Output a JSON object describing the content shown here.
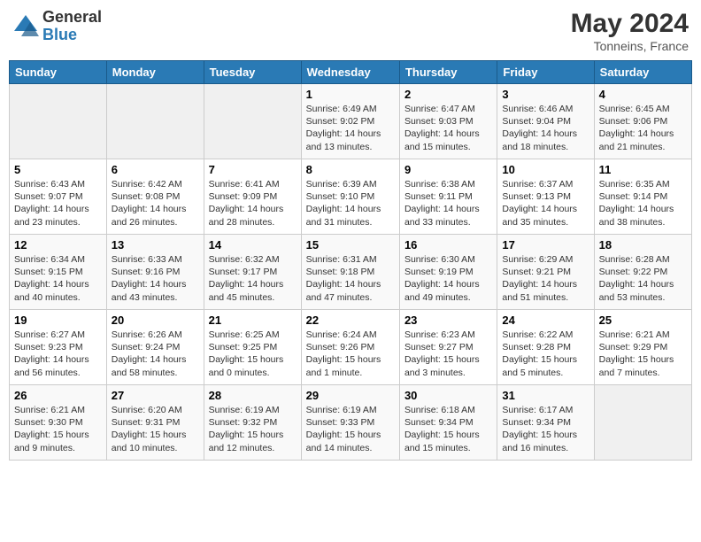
{
  "header": {
    "logo_general": "General",
    "logo_blue": "Blue",
    "month_year": "May 2024",
    "location": "Tonneins, France"
  },
  "days_of_week": [
    "Sunday",
    "Monday",
    "Tuesday",
    "Wednesday",
    "Thursday",
    "Friday",
    "Saturday"
  ],
  "weeks": [
    [
      {
        "num": "",
        "info": ""
      },
      {
        "num": "",
        "info": ""
      },
      {
        "num": "",
        "info": ""
      },
      {
        "num": "1",
        "info": "Sunrise: 6:49 AM\nSunset: 9:02 PM\nDaylight: 14 hours and 13 minutes."
      },
      {
        "num": "2",
        "info": "Sunrise: 6:47 AM\nSunset: 9:03 PM\nDaylight: 14 hours and 15 minutes."
      },
      {
        "num": "3",
        "info": "Sunrise: 6:46 AM\nSunset: 9:04 PM\nDaylight: 14 hours and 18 minutes."
      },
      {
        "num": "4",
        "info": "Sunrise: 6:45 AM\nSunset: 9:06 PM\nDaylight: 14 hours and 21 minutes."
      }
    ],
    [
      {
        "num": "5",
        "info": "Sunrise: 6:43 AM\nSunset: 9:07 PM\nDaylight: 14 hours and 23 minutes."
      },
      {
        "num": "6",
        "info": "Sunrise: 6:42 AM\nSunset: 9:08 PM\nDaylight: 14 hours and 26 minutes."
      },
      {
        "num": "7",
        "info": "Sunrise: 6:41 AM\nSunset: 9:09 PM\nDaylight: 14 hours and 28 minutes."
      },
      {
        "num": "8",
        "info": "Sunrise: 6:39 AM\nSunset: 9:10 PM\nDaylight: 14 hours and 31 minutes."
      },
      {
        "num": "9",
        "info": "Sunrise: 6:38 AM\nSunset: 9:11 PM\nDaylight: 14 hours and 33 minutes."
      },
      {
        "num": "10",
        "info": "Sunrise: 6:37 AM\nSunset: 9:13 PM\nDaylight: 14 hours and 35 minutes."
      },
      {
        "num": "11",
        "info": "Sunrise: 6:35 AM\nSunset: 9:14 PM\nDaylight: 14 hours and 38 minutes."
      }
    ],
    [
      {
        "num": "12",
        "info": "Sunrise: 6:34 AM\nSunset: 9:15 PM\nDaylight: 14 hours and 40 minutes."
      },
      {
        "num": "13",
        "info": "Sunrise: 6:33 AM\nSunset: 9:16 PM\nDaylight: 14 hours and 43 minutes."
      },
      {
        "num": "14",
        "info": "Sunrise: 6:32 AM\nSunset: 9:17 PM\nDaylight: 14 hours and 45 minutes."
      },
      {
        "num": "15",
        "info": "Sunrise: 6:31 AM\nSunset: 9:18 PM\nDaylight: 14 hours and 47 minutes."
      },
      {
        "num": "16",
        "info": "Sunrise: 6:30 AM\nSunset: 9:19 PM\nDaylight: 14 hours and 49 minutes."
      },
      {
        "num": "17",
        "info": "Sunrise: 6:29 AM\nSunset: 9:21 PM\nDaylight: 14 hours and 51 minutes."
      },
      {
        "num": "18",
        "info": "Sunrise: 6:28 AM\nSunset: 9:22 PM\nDaylight: 14 hours and 53 minutes."
      }
    ],
    [
      {
        "num": "19",
        "info": "Sunrise: 6:27 AM\nSunset: 9:23 PM\nDaylight: 14 hours and 56 minutes."
      },
      {
        "num": "20",
        "info": "Sunrise: 6:26 AM\nSunset: 9:24 PM\nDaylight: 14 hours and 58 minutes."
      },
      {
        "num": "21",
        "info": "Sunrise: 6:25 AM\nSunset: 9:25 PM\nDaylight: 15 hours and 0 minutes."
      },
      {
        "num": "22",
        "info": "Sunrise: 6:24 AM\nSunset: 9:26 PM\nDaylight: 15 hours and 1 minute."
      },
      {
        "num": "23",
        "info": "Sunrise: 6:23 AM\nSunset: 9:27 PM\nDaylight: 15 hours and 3 minutes."
      },
      {
        "num": "24",
        "info": "Sunrise: 6:22 AM\nSunset: 9:28 PM\nDaylight: 15 hours and 5 minutes."
      },
      {
        "num": "25",
        "info": "Sunrise: 6:21 AM\nSunset: 9:29 PM\nDaylight: 15 hours and 7 minutes."
      }
    ],
    [
      {
        "num": "26",
        "info": "Sunrise: 6:21 AM\nSunset: 9:30 PM\nDaylight: 15 hours and 9 minutes."
      },
      {
        "num": "27",
        "info": "Sunrise: 6:20 AM\nSunset: 9:31 PM\nDaylight: 15 hours and 10 minutes."
      },
      {
        "num": "28",
        "info": "Sunrise: 6:19 AM\nSunset: 9:32 PM\nDaylight: 15 hours and 12 minutes."
      },
      {
        "num": "29",
        "info": "Sunrise: 6:19 AM\nSunset: 9:33 PM\nDaylight: 15 hours and 14 minutes."
      },
      {
        "num": "30",
        "info": "Sunrise: 6:18 AM\nSunset: 9:34 PM\nDaylight: 15 hours and 15 minutes."
      },
      {
        "num": "31",
        "info": "Sunrise: 6:17 AM\nSunset: 9:34 PM\nDaylight: 15 hours and 16 minutes."
      },
      {
        "num": "",
        "info": ""
      }
    ]
  ]
}
